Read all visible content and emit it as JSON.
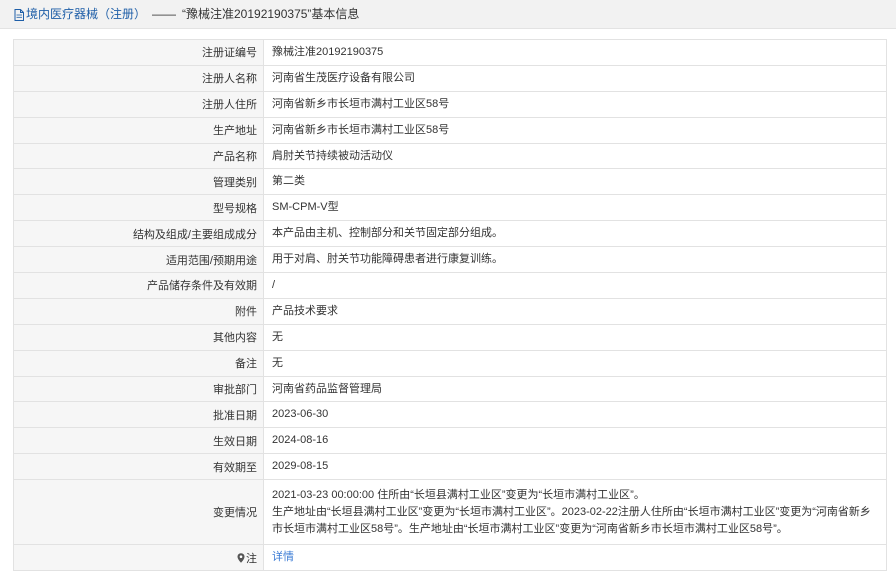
{
  "header": {
    "category": "境内医疗器械（注册）",
    "separator": "——",
    "title": "“豫械注准20192190375”基本信息"
  },
  "rows": [
    {
      "label": "注册证编号",
      "value": "豫械注准20192190375"
    },
    {
      "label": "注册人名称",
      "value": "河南省生茂医疗设备有限公司"
    },
    {
      "label": "注册人住所",
      "value": "河南省新乡市长垣市满村工业区58号"
    },
    {
      "label": "生产地址",
      "value": "河南省新乡市长垣市满村工业区58号"
    },
    {
      "label": "产品名称",
      "value": "肩肘关节持续被动活动仪"
    },
    {
      "label": "管理类别",
      "value": "第二类"
    },
    {
      "label": "型号规格",
      "value": "SM-CPM-V型"
    },
    {
      "label": "结构及组成/主要组成成分",
      "value": "本产品由主机、控制部分和关节固定部分组成。"
    },
    {
      "label": "适用范围/预期用途",
      "value": "用于对肩、肘关节功能障碍患者进行康复训练。"
    },
    {
      "label": "产品储存条件及有效期",
      "value": "/"
    },
    {
      "label": "附件",
      "value": "产品技术要求"
    },
    {
      "label": "其他内容",
      "value": "无"
    },
    {
      "label": "备注",
      "value": "无"
    },
    {
      "label": "审批部门",
      "value": "河南省药品监督管理局"
    },
    {
      "label": "批准日期",
      "value": "2023-06-30"
    },
    {
      "label": "生效日期",
      "value": "2024-08-16"
    },
    {
      "label": "有效期至",
      "value": "2029-08-15"
    }
  ],
  "changes": {
    "label": "变更情况",
    "line1": "2021-03-23 00:00:00 住所由“长垣县满村工业区”变更为“长垣市满村工业区”。",
    "line2": "生产地址由“长垣县满村工业区”变更为“长垣市满村工业区”。2023-02-22注册人住所由“长垣市满村工业区”变更为“河南省新乡市长垣市满村工业区58号”。生产地址由“长垣市满村工业区”变更为“河南省新乡市长垣市满村工业区58号”。"
  },
  "note": {
    "label": "注",
    "link": "详情",
    "icon": "location-pin-icon"
  },
  "colors": {
    "header_bg": "#f2f2f2",
    "label_bg": "#f6f6f6",
    "border": "#e2e2e2",
    "link": "#3a7bd5"
  }
}
